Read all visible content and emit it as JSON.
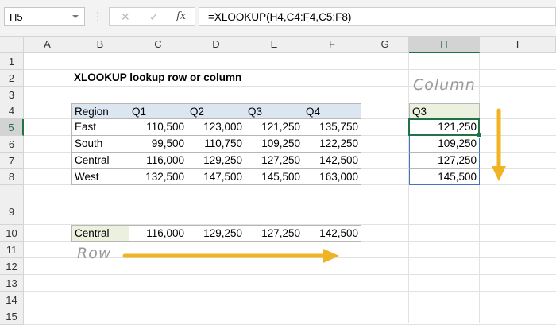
{
  "name_box": "H5",
  "formula_bar": {
    "cancel_icon": "✕",
    "enter_icon": "✓",
    "fx_label": "fx",
    "formula": "=XLOOKUP(H4,C4:F4,C5:F8)"
  },
  "columns": [
    "A",
    "B",
    "C",
    "D",
    "E",
    "F",
    "G",
    "H",
    "I"
  ],
  "rows": [
    "1",
    "2",
    "3",
    "4",
    "5",
    "6",
    "7",
    "8",
    "9",
    "10",
    "11",
    "12",
    "13",
    "14",
    "15"
  ],
  "selected_cell": "H5",
  "cells": [
    {
      "ref": "B2",
      "value": "XLOOKUP lookup row or column"
    },
    {
      "ref": "B4",
      "value": "Region"
    },
    {
      "ref": "C4",
      "value": "Q1"
    },
    {
      "ref": "D4",
      "value": "Q2"
    },
    {
      "ref": "E4",
      "value": "Q3"
    },
    {
      "ref": "F4",
      "value": "Q4"
    },
    {
      "ref": "B5",
      "value": "East"
    },
    {
      "ref": "C5",
      "value": "110,500"
    },
    {
      "ref": "D5",
      "value": "123,000"
    },
    {
      "ref": "E5",
      "value": "121,250"
    },
    {
      "ref": "F5",
      "value": "135,750"
    },
    {
      "ref": "B6",
      "value": "South"
    },
    {
      "ref": "C6",
      "value": "99,500"
    },
    {
      "ref": "D6",
      "value": "110,750"
    },
    {
      "ref": "E6",
      "value": "109,250"
    },
    {
      "ref": "F6",
      "value": "122,250"
    },
    {
      "ref": "B7",
      "value": "Central"
    },
    {
      "ref": "C7",
      "value": "116,000"
    },
    {
      "ref": "D7",
      "value": "129,250"
    },
    {
      "ref": "E7",
      "value": "127,250"
    },
    {
      "ref": "F7",
      "value": "142,500"
    },
    {
      "ref": "B8",
      "value": "West"
    },
    {
      "ref": "C8",
      "value": "132,500"
    },
    {
      "ref": "D8",
      "value": "147,500"
    },
    {
      "ref": "E8",
      "value": "145,500"
    },
    {
      "ref": "F8",
      "value": "163,000"
    },
    {
      "ref": "H4",
      "value": "Q3"
    },
    {
      "ref": "H5",
      "value": "121,250"
    },
    {
      "ref": "H6",
      "value": "109,250"
    },
    {
      "ref": "H7",
      "value": "127,250"
    },
    {
      "ref": "H8",
      "value": "145,500"
    },
    {
      "ref": "B10",
      "value": "Central"
    },
    {
      "ref": "C10",
      "value": "116,000"
    },
    {
      "ref": "D10",
      "value": "129,250"
    },
    {
      "ref": "E10",
      "value": "127,250"
    },
    {
      "ref": "F10",
      "value": "142,500"
    }
  ],
  "annotations": {
    "column_label": "Column",
    "row_label": "Row",
    "arrow_color": "#f0b323"
  }
}
